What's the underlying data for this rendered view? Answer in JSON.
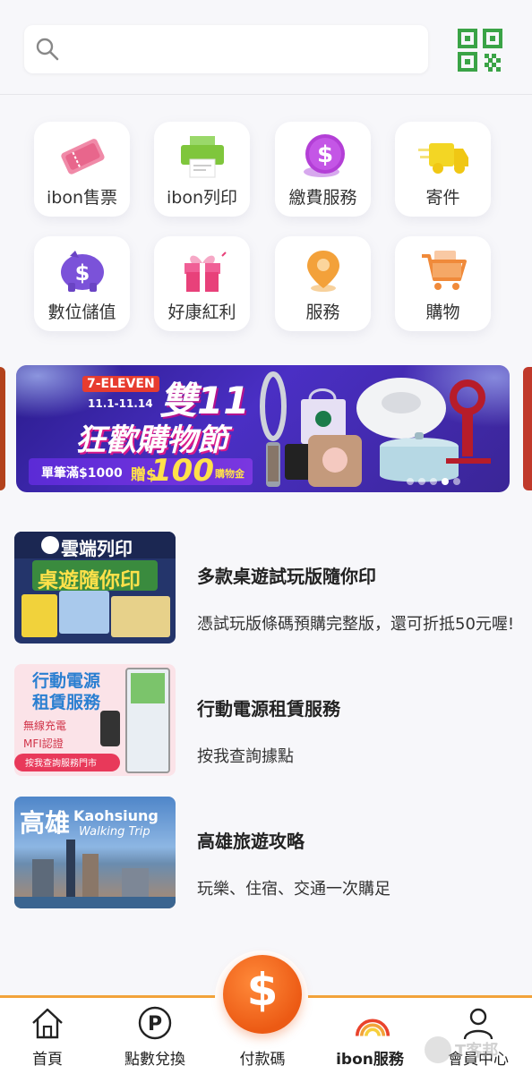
{
  "header": {
    "search_placeholder": "",
    "qr_icon": "qr-code-icon"
  },
  "services": [
    {
      "label": "ibon售票",
      "icon": "ticket-icon",
      "color": "#e8668c"
    },
    {
      "label": "ibon列印",
      "icon": "printer-icon",
      "color": "#7fc63c"
    },
    {
      "label": "繳費服務",
      "icon": "dollar-coin-icon",
      "color": "#b33fd6"
    },
    {
      "label": "寄件",
      "icon": "delivery-truck-icon",
      "color": "#f3d624"
    },
    {
      "label": "數位儲值",
      "icon": "piggy-bank-icon",
      "color": "#7b52d9"
    },
    {
      "label": "好康紅利",
      "icon": "gift-icon",
      "color": "#e8417a"
    },
    {
      "label": "服務",
      "icon": "map-pin-icon",
      "color": "#f3a13a"
    },
    {
      "label": "購物",
      "icon": "shopping-cart-icon",
      "color": "#f08a3a"
    }
  ],
  "banner": {
    "brand": "7-ELEVEN",
    "dates": "11.1-11.14",
    "headline": "雙11",
    "subheadline": "狂歡購物節",
    "promo_prefix": "單筆滿$1000",
    "promo_gift": "贈$",
    "promo_amount": "100",
    "promo_suffix": "購物金",
    "slide_count": 5,
    "active_slide": 4
  },
  "news": [
    {
      "title": "多款桌遊試玩版隨你印",
      "desc": "憑試玩版條碼預購完整版，還可折抵50元喔!",
      "thumb_header": "雲端列印",
      "thumb_subheader": "桌遊隨你印"
    },
    {
      "title": "行動電源租賃服務",
      "desc": "按我查詢據點",
      "thumb_line1": "行動電源",
      "thumb_line2": "租賃服務",
      "thumb_badge1": "無線充電",
      "thumb_badge2": "MFI認證",
      "thumb_bar": "按我查詢服務門市"
    },
    {
      "title": "高雄旅遊攻略",
      "desc": "玩樂、住宿、交通一次購足",
      "thumb_title_cn": "高雄",
      "thumb_title_en": "Kaohsiung",
      "thumb_subtitle": "Walking Trip"
    }
  ],
  "tabbar": {
    "tabs": [
      {
        "label": "首頁",
        "icon": "home-icon"
      },
      {
        "label": "點數兌換",
        "icon": "points-p-icon"
      },
      {
        "label": "付款碼",
        "icon": "dollar-pay-icon"
      },
      {
        "label": "ibon服務",
        "icon": "ibon-rainbow-icon",
        "active": true
      },
      {
        "label": "會員中心",
        "icon": "user-profile-icon"
      }
    ],
    "pay_symbol": "$",
    "accent": "#f2a33a"
  },
  "watermark": "T客邦"
}
